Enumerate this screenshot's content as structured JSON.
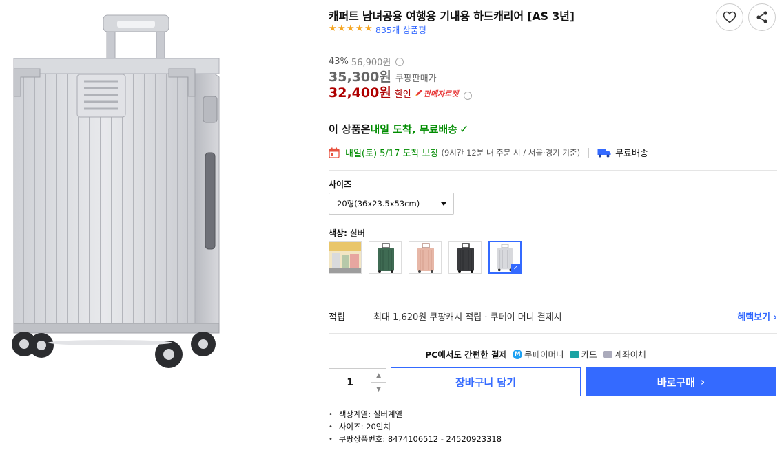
{
  "product": {
    "title": "캐퍼트 남녀공용 여행용 기내용 하드캐리어 [AS 3년]",
    "rating_stars": 5,
    "review_count": "835개 상품평"
  },
  "pricing": {
    "discount_rate": "43%",
    "original_price": "56,900원",
    "coupang_price": "35,300원",
    "coupang_price_label": "쿠팡판매가",
    "sale_price": "32,400원",
    "sale_label": "할인",
    "seller_rocket": "판매자로켓",
    "info_glyph": "i"
  },
  "delivery": {
    "headline_prefix": "이 상품은 ",
    "headline_highlight": "내일 도착, 무료배송",
    "date_text": "내일(토) 5/17 도착 보장",
    "condition_text": "(9시간 12분  내 주문 시 / 서울·경기 기준)",
    "free_shipping": "무료배송"
  },
  "options": {
    "size_label": "사이즈",
    "size_selected": "20형(36x23.5x53cm)",
    "color_label": "색상",
    "color_selected": "실버",
    "swatches": [
      {
        "name": "lifestyle",
        "selected": false
      },
      {
        "name": "green",
        "selected": false
      },
      {
        "name": "rose-pink",
        "selected": false
      },
      {
        "name": "black",
        "selected": false
      },
      {
        "name": "silver",
        "selected": true
      }
    ]
  },
  "reward": {
    "label": "적립",
    "text_prefix": "최대 1,620원 ",
    "text_link": "쿠팡캐시 적립",
    "text_suffix": " · 쿠페이 머니 결제시",
    "benefit_link": "혜택보기"
  },
  "payment": {
    "headline": "PC에서도 간편한 결제",
    "methods": [
      "쿠페이머니",
      "카드",
      "계좌이체"
    ]
  },
  "purchase": {
    "quantity": "1",
    "cart_button": "장바구니 담기",
    "buy_button": "바로구매",
    "buy_arrow": "›"
  },
  "details": [
    "색상계열: 실버계열",
    "사이즈: 20인치",
    "쿠팡상품번호: 8474106512 - 24520923318"
  ],
  "colors": {
    "accent": "#346aff",
    "sale_red": "#ae0000",
    "delivery_green": "#008c00"
  }
}
